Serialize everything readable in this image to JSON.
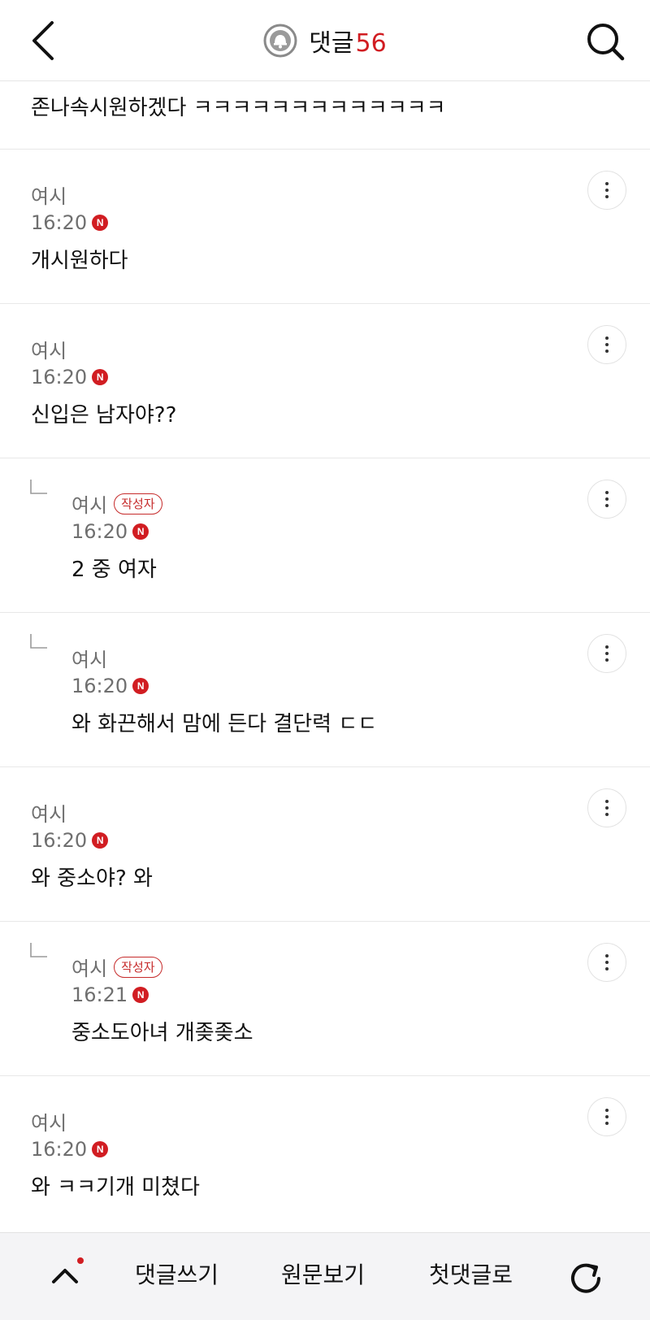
{
  "header": {
    "title": "댓글",
    "count": "56"
  },
  "prev_fragment": "존나속시원하겠다 ㅋㅋㅋㅋㅋㅋㅋㅋㅋㅋㅋㅋㅋ",
  "comments": [
    {
      "author": "여시",
      "badge": "",
      "time": "16:20",
      "text": "개시원하다"
    },
    {
      "author": "여시",
      "badge": "",
      "time": "16:20",
      "text": "신입은 남자야??"
    },
    {
      "author": "여시",
      "badge": "작성자",
      "time": "16:20",
      "text": "2 중 여자"
    },
    {
      "author": "여시",
      "badge": "",
      "time": "16:20",
      "text": "와 화끈해서 맘에 든다 결단력 ㄷㄷ"
    },
    {
      "author": "여시",
      "badge": "",
      "time": "16:20",
      "text": "와 중소야? 와"
    },
    {
      "author": "여시",
      "badge": "작성자",
      "time": "16:21",
      "text": "중소도아녀 개좆좆소"
    },
    {
      "author": "여시",
      "badge": "",
      "time": "16:20",
      "text": "와 ㅋㅋ기개 미쳤다"
    }
  ],
  "new_badge": "N",
  "bottom_bar": {
    "write_label": "댓글쓰기",
    "original_label": "원문보기",
    "first_label": "첫댓글로"
  },
  "icons": {
    "back": "chevron-left-icon",
    "bell": "bell-icon",
    "search": "search-icon",
    "more": "more-vertical-icon",
    "reply": "reply-corner-icon",
    "up": "chevron-up-icon",
    "refresh": "refresh-icon"
  },
  "colors": {
    "accent": "#d11d22",
    "badge_border": "#c62b2b",
    "meta_text": "#6f6f6f"
  }
}
